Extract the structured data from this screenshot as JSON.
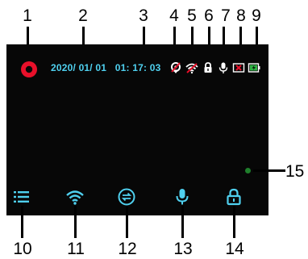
{
  "callouts": {
    "top": [
      "1",
      "2",
      "3",
      "4",
      "5",
      "6",
      "7",
      "8",
      "9"
    ],
    "bottom": [
      "10",
      "11",
      "12",
      "13",
      "14"
    ],
    "right": "15"
  },
  "status_bar": {
    "recording_icon": "record-icon",
    "date": "2020/ 01/ 01",
    "time": "01: 17: 03",
    "icons": [
      "gps-icon",
      "wifi-off-icon",
      "lock-icon",
      "microphone-icon",
      "sd-card-error-icon",
      "battery-charging-icon"
    ]
  },
  "bottom_bar": {
    "icons": [
      "menu-icon",
      "wifi-icon",
      "switch-camera-icon",
      "microphone-icon",
      "lock-icon"
    ]
  },
  "colors": {
    "accent": "#4fd0ef",
    "record": "#e8102a",
    "screen_background": "#070707",
    "indicator": "#1f7f2c",
    "error": "#e8102a",
    "battery": "#2fb344"
  }
}
